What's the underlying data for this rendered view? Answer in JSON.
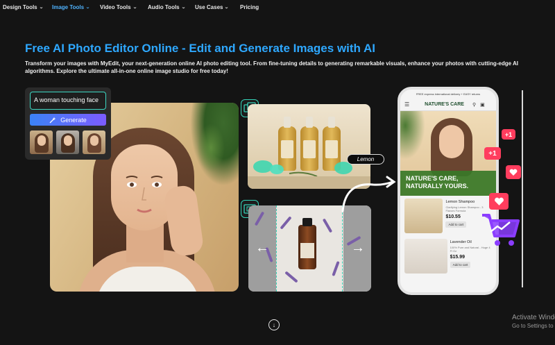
{
  "nav": {
    "items": [
      {
        "label": "Design Tools",
        "dropdown": true
      },
      {
        "label": "Image Tools",
        "dropdown": true,
        "active": true
      },
      {
        "label": "Video Tools",
        "dropdown": true
      },
      {
        "label": "Audio Tools",
        "dropdown": true
      },
      {
        "label": "Use Cases",
        "dropdown": true
      },
      {
        "label": "Pricing",
        "dropdown": false
      }
    ]
  },
  "hero": {
    "title": "Free AI Photo Editor Online - Edit and Generate Images with AI",
    "subtitle": "Transform your images with MyEdit, your next-generation online AI photo editing tool. From fine-tuning details to generating remarkable visuals, enhance your photos with cutting-edge AI algorithms. Explore the ultimate all-in-one online image studio for free today!"
  },
  "prompt_card": {
    "input_value": "A woman touching face",
    "generate_label": "Generate"
  },
  "product_card": {
    "tag": "Lemon"
  },
  "phone": {
    "promo_text": "FREE express international delivery + EASY returns",
    "shop_name": "NATURE'S CARE",
    "tagline_line1": "NATURE'S CARE,",
    "tagline_line2": "NATURALLY YOURS.",
    "products": [
      {
        "name": "Lemon Shampoo",
        "desc": "Clarifying Lemon Shampoo - 3 Flavors Formula",
        "price": "$10.55",
        "cart": "Add to cart"
      },
      {
        "name": "Lavender Oil",
        "desc": "100% Pure and Natural - Huge 4 Fl Oz",
        "price": "$15.99",
        "cart": "Add to cart"
      }
    ]
  },
  "badges": {
    "plus1_a": "+1",
    "plus1_b": "+1"
  },
  "overlay": {
    "activate_line1": "Activate Windows",
    "activate_line2": "Go to Settings to activate Windows."
  },
  "colors": {
    "accent": "#2ea8ff",
    "teal": "#35d3b8",
    "like": "#ff3d5e",
    "cart": "#8b3dff"
  }
}
